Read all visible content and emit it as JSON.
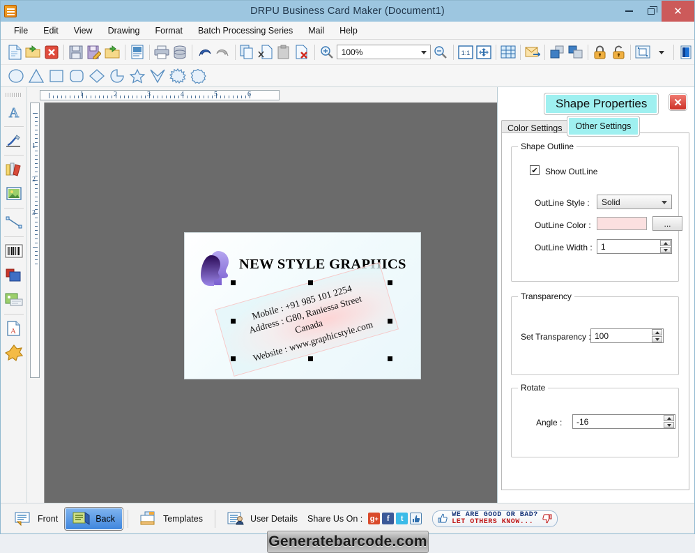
{
  "window": {
    "title": "DRPU Business Card Maker (Document1)",
    "minimize": "–",
    "restore": "❐",
    "close": "✕",
    "app_icon": "app-document-icon"
  },
  "menu": [
    {
      "label": "File"
    },
    {
      "label": "Edit"
    },
    {
      "label": "View"
    },
    {
      "label": "Drawing"
    },
    {
      "label": "Format"
    },
    {
      "label": "Batch Processing Series"
    },
    {
      "label": "Mail"
    },
    {
      "label": "Help"
    }
  ],
  "toolbar": {
    "zoom_value": "100%",
    "icons": [
      "new-document-icon",
      "open-folder-icon",
      "close-document-icon",
      "save-icon",
      "save-as-icon",
      "import-folder-icon",
      "properties-icon",
      "print-icon",
      "database-icon",
      "undo-icon",
      "redo-icon",
      "copy-icon",
      "cut-icon",
      "paste-icon",
      "delete-icon",
      "zoom-in-icon",
      "zoom-out-icon",
      "actual-size-icon",
      "fit-page-icon",
      "grid-icon",
      "email-icon",
      "bring-to-front-icon",
      "send-to-back-icon",
      "lock-icon",
      "unlock-icon",
      "align-icon",
      "color-palette-icon"
    ],
    "shapes": [
      "ellipse-shape-icon",
      "triangle-shape-icon",
      "rectangle-shape-icon",
      "rounded-rectangle-shape-icon",
      "diamond-shape-icon",
      "pie-shape-icon",
      "star5-shape-icon",
      "four-point-star-shape-icon",
      "explosion-shape-icon",
      "seal-shape-icon"
    ]
  },
  "left_tools": [
    "text-tool-icon",
    "signature-tool-icon",
    "barcode-batch-tool-icon",
    "image-tool-icon",
    "line-tool-icon",
    "barcode-tool-icon",
    "layers-tool-icon",
    "picture-frame-tool-icon",
    "text-document-tool-icon",
    "shape-blob-tool-icon"
  ],
  "rulers": {
    "horizontal_labels": [
      "1",
      "2",
      "3",
      "4",
      "5",
      "6"
    ],
    "vertical_labels": [
      "1",
      "2",
      "3"
    ]
  },
  "card": {
    "brand": "NEW STYLE GRAPHICS",
    "logo": "faces-logo-icon",
    "rotated_text": [
      "Mobile    : +91 985 101 2254",
      "Address : G80, Raniessa Street",
      "Canada",
      "Website : www.graphicstyle.com"
    ]
  },
  "panel": {
    "title": "Shape Properties",
    "close_label": "✕",
    "tabs": [
      {
        "label": "Color Settings",
        "active": false
      },
      {
        "label": "Other Settings",
        "active": true
      }
    ],
    "shape_outline": {
      "group_label": "Shape Outline",
      "show_outline_label": "Show OutLine",
      "show_outline_checked": "✔",
      "outline_style_label": "OutLine Style :",
      "outline_style_value": "Solid",
      "outline_color_label": "OutLine Color :",
      "outline_color_value": "#fbe0e0",
      "outline_color_button": "...",
      "outline_width_label": "OutLine Width :",
      "outline_width_value": "1"
    },
    "transparency": {
      "group_label": "Transparency",
      "set_transparency_label": "Set Transparency :",
      "set_transparency_value": "100"
    },
    "rotate": {
      "group_label": "Rotate",
      "angle_label": "Angle :",
      "angle_value": "-16"
    }
  },
  "bottom": {
    "front_label": "Front",
    "back_label": "Back",
    "templates_label": "Templates",
    "user_details_label": "User Details",
    "share_label": "Share Us On :",
    "share_icons": [
      "google-plus-icon",
      "facebook-icon",
      "twitter-icon",
      "thumbs-up-icon"
    ],
    "rate_line1": "WE  ARE  GOOD  OR  BAD?",
    "rate_line2": "LET OTHERS KNOW...",
    "watermark": "Generatebarcode.com"
  },
  "colors": {
    "titlebar": "#9dc6e0",
    "close_button": "#cc5a5a",
    "accent_cyan": "#9ff0f0",
    "canvas_bg": "#6b6b6b",
    "active_tab_blue": "#3f86dd"
  }
}
